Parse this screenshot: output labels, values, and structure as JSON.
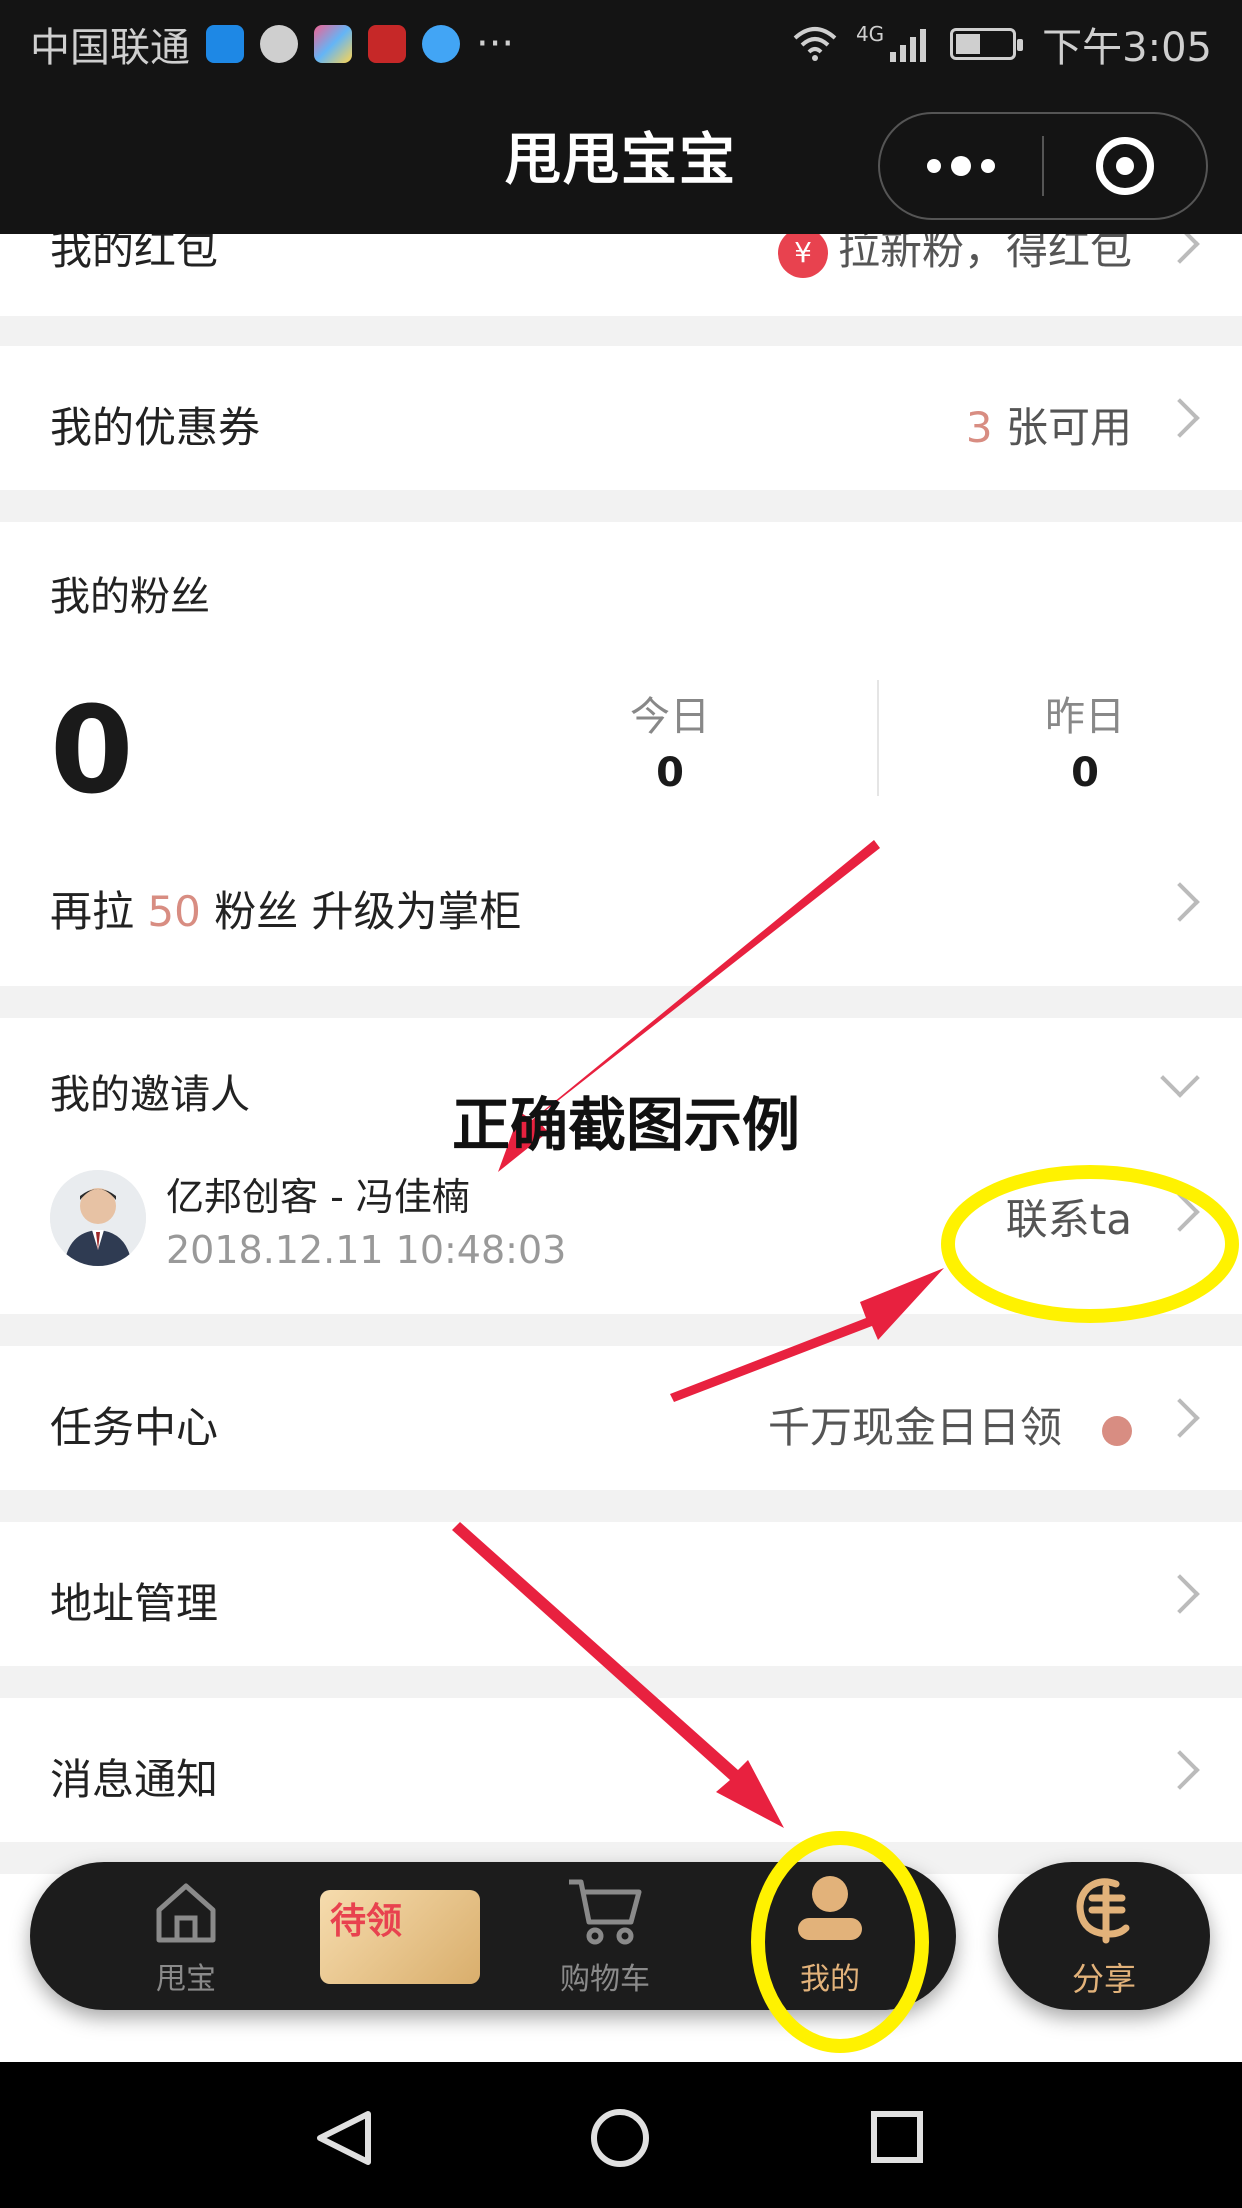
{
  "status_bar": {
    "carrier": "中国联通",
    "time": "下午3:05",
    "network": "4G"
  },
  "title_bar": {
    "title": "甩甩宝宝"
  },
  "red_packet": {
    "label": "我的红包",
    "hint": "拉新粉，得红包"
  },
  "coupons": {
    "label": "我的优惠券",
    "count": "3",
    "suffix": "张可用"
  },
  "fans": {
    "label": "我的粉丝",
    "total": "0",
    "today_label": "今日",
    "today_value": "0",
    "yesterday_label": "昨日",
    "yesterday_value": "0",
    "upgrade_prefix": "再拉",
    "upgrade_count": "50",
    "upgrade_suffix": "粉丝 升级为掌柜"
  },
  "inviter": {
    "label": "我的邀请人",
    "name": "亿邦创客 - 冯佳楠",
    "time": "2018.12.11 10:48:03",
    "contact": "联系ta"
  },
  "tasks": {
    "label": "任务中心",
    "hint": "千万现金日日领"
  },
  "address": {
    "label": "地址管理"
  },
  "messages": {
    "label": "消息通知"
  },
  "annotation": {
    "text": "正确截图示例"
  },
  "tabbar": {
    "items": [
      {
        "label": "甩宝",
        "icon": "home-icon"
      },
      {
        "label": "待领",
        "icon": "coupon-icon"
      },
      {
        "label": "购物车",
        "icon": "cart-icon"
      },
      {
        "label": "我的",
        "icon": "user-icon"
      }
    ],
    "share": "分享"
  },
  "colors": {
    "accent": "#d88d82",
    "dark": "#141414",
    "gold": "#e2b27a",
    "annotation_red": "#e8213f",
    "annotation_yellow": "#fff200"
  }
}
